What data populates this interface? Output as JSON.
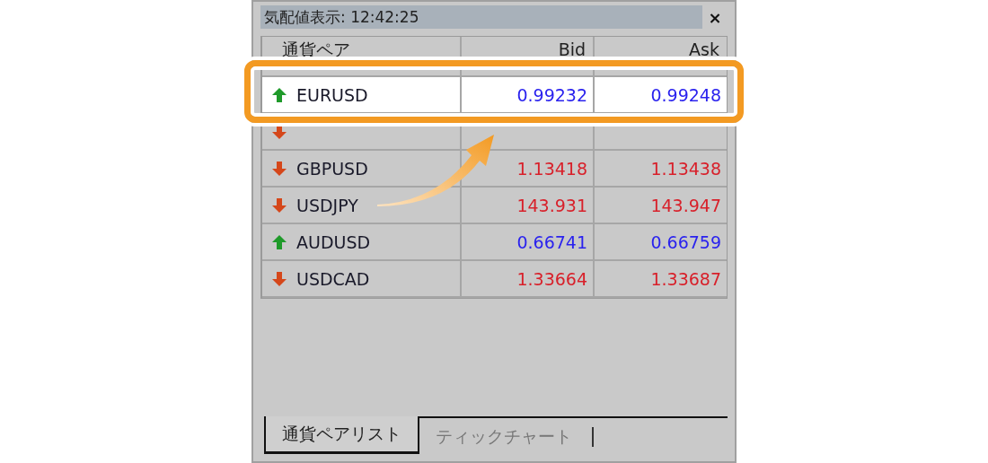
{
  "window": {
    "title": "気配値表示: 12:42:25",
    "close": "×"
  },
  "table": {
    "columns": [
      "通貨ペア",
      "Bid",
      "Ask"
    ],
    "rows": [
      {
        "pair": "EURUSD",
        "up": true,
        "bid": "0.99232",
        "ask": "0.99248",
        "selected": true
      },
      {
        "up": false,
        "selected": false
      },
      {
        "pair": "GBPUSD",
        "up": false,
        "bid": "1.13418",
        "ask": "1.13438",
        "selected": false
      },
      {
        "pair": "USDJPY",
        "up": false,
        "bid": "143.931",
        "ask": "143.947",
        "selected": false
      },
      {
        "pair": "AUDUSD",
        "up": true,
        "bid": "0.66741",
        "ask": "0.66759",
        "selected": false
      },
      {
        "pair": "USDCAD",
        "up": false,
        "bid": "1.33664",
        "ask": "1.33687",
        "selected": false
      }
    ]
  },
  "tabs": [
    {
      "label": "通貨ペアリスト",
      "selected": true
    },
    {
      "label": "ティックチャート",
      "selected": false
    }
  ]
}
